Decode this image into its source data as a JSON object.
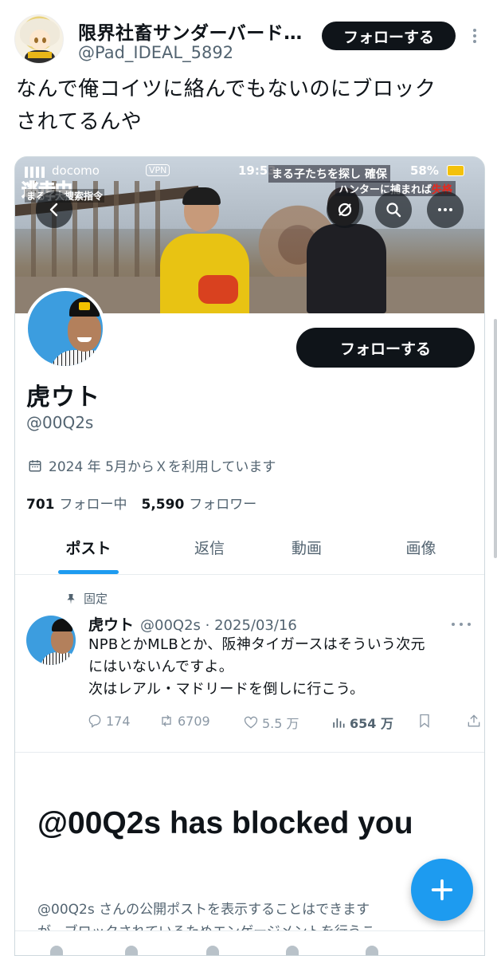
{
  "outer_tweet": {
    "author_name": "限界社畜サンダーバード…",
    "author_handle": "@Pad_IDEAL_5892",
    "follow_label": "フォローする",
    "text_line1": "なんで俺コイツに絡んでもないのにブロック",
    "text_line2": "されてるんや"
  },
  "screenshot": {
    "status_bar": {
      "carrier": "docomo",
      "vpn": "VPN",
      "time": "19:53",
      "battery": "58%"
    },
    "banner_overlay": {
      "title": "逃走中",
      "subtitle": "まる子大捜索指令",
      "caption1": "まる子たちを探し 確保",
      "caption2a": "ハンターに捕まれば",
      "caption2b": "失格"
    },
    "profile": {
      "display_name": "虎ウト",
      "handle": "@00Q2s",
      "follow_label": "フォローする",
      "joined": "2024 年 5月からＸを利用しています",
      "following_count": "701",
      "following_label": "フォロー中",
      "followers_count": "5,590",
      "followers_label": "フォロワー"
    },
    "tabs": [
      {
        "label": "ポスト",
        "active": true
      },
      {
        "label": "返信",
        "active": false
      },
      {
        "label": "動画",
        "active": false
      },
      {
        "label": "画像",
        "active": false
      }
    ],
    "pinned_post": {
      "pinned_label": "固定",
      "author": "虎ウト",
      "meta": "@00Q2s · 2025/03/16",
      "line1": "NPBとかMLBとか、阪神タイガースはそういう次元",
      "line2": "にはいないんですよ。",
      "line3": "次はレアル・マドリードを倒しに行こう。",
      "replies": "174",
      "reposts": "6709",
      "likes": "5.5 万",
      "views": "654 万"
    },
    "blocked": {
      "title": "@00Q2s has blocked you",
      "desc_line1": "@00Q2s さんの公開ポストを表示することはできます",
      "desc_line2": "が、ブロックされているためエンゲージメントを行うこ"
    }
  },
  "colors": {
    "accent": "#1d9bf0",
    "text": "#0f1419",
    "muted": "#536471",
    "button_dark": "#0f1419"
  }
}
